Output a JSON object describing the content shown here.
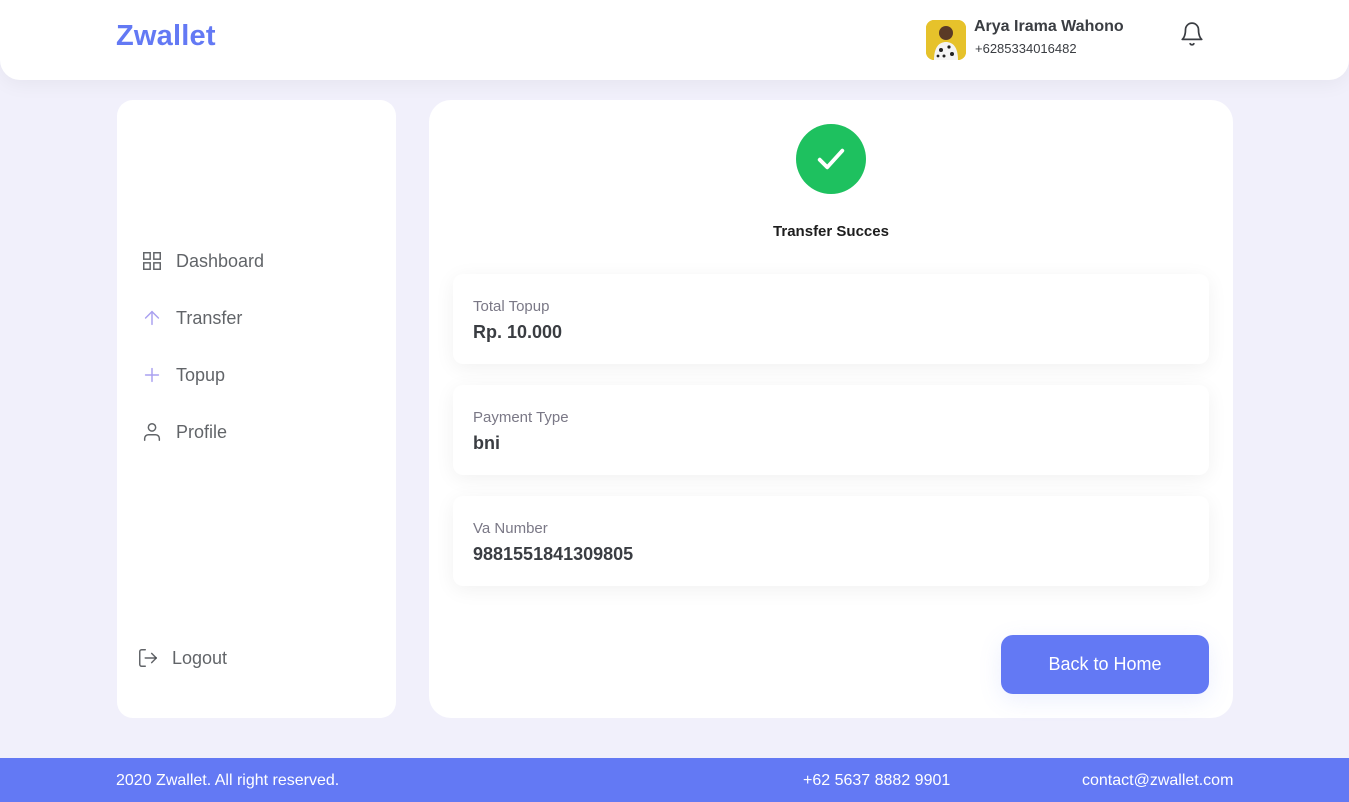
{
  "header": {
    "brand": "Zwallet",
    "user_name": "Arya Irama Wahono",
    "user_phone": "+6285334016482"
  },
  "sidebar": {
    "items": [
      {
        "label": "Dashboard",
        "icon": "grid-icon"
      },
      {
        "label": "Transfer",
        "icon": "arrow-up-icon"
      },
      {
        "label": "Topup",
        "icon": "plus-icon"
      },
      {
        "label": "Profile",
        "icon": "user-icon"
      }
    ],
    "logout_label": "Logout"
  },
  "main": {
    "status_title": "Transfer Succes",
    "details": [
      {
        "label": "Total Topup",
        "value": "Rp. 10.000"
      },
      {
        "label": "Payment Type",
        "value": "bni"
      },
      {
        "label": "Va Number",
        "value": "9881551841309805"
      }
    ],
    "back_button_label": "Back to Home"
  },
  "footer": {
    "copyright": "2020 Zwallet. All right reserved.",
    "phone": "+62 5637 8882 9901",
    "email": "contact@zwallet.com"
  },
  "colors": {
    "primary": "#6379f4",
    "success": "#1ec15f",
    "background": "#f1f0fb"
  }
}
